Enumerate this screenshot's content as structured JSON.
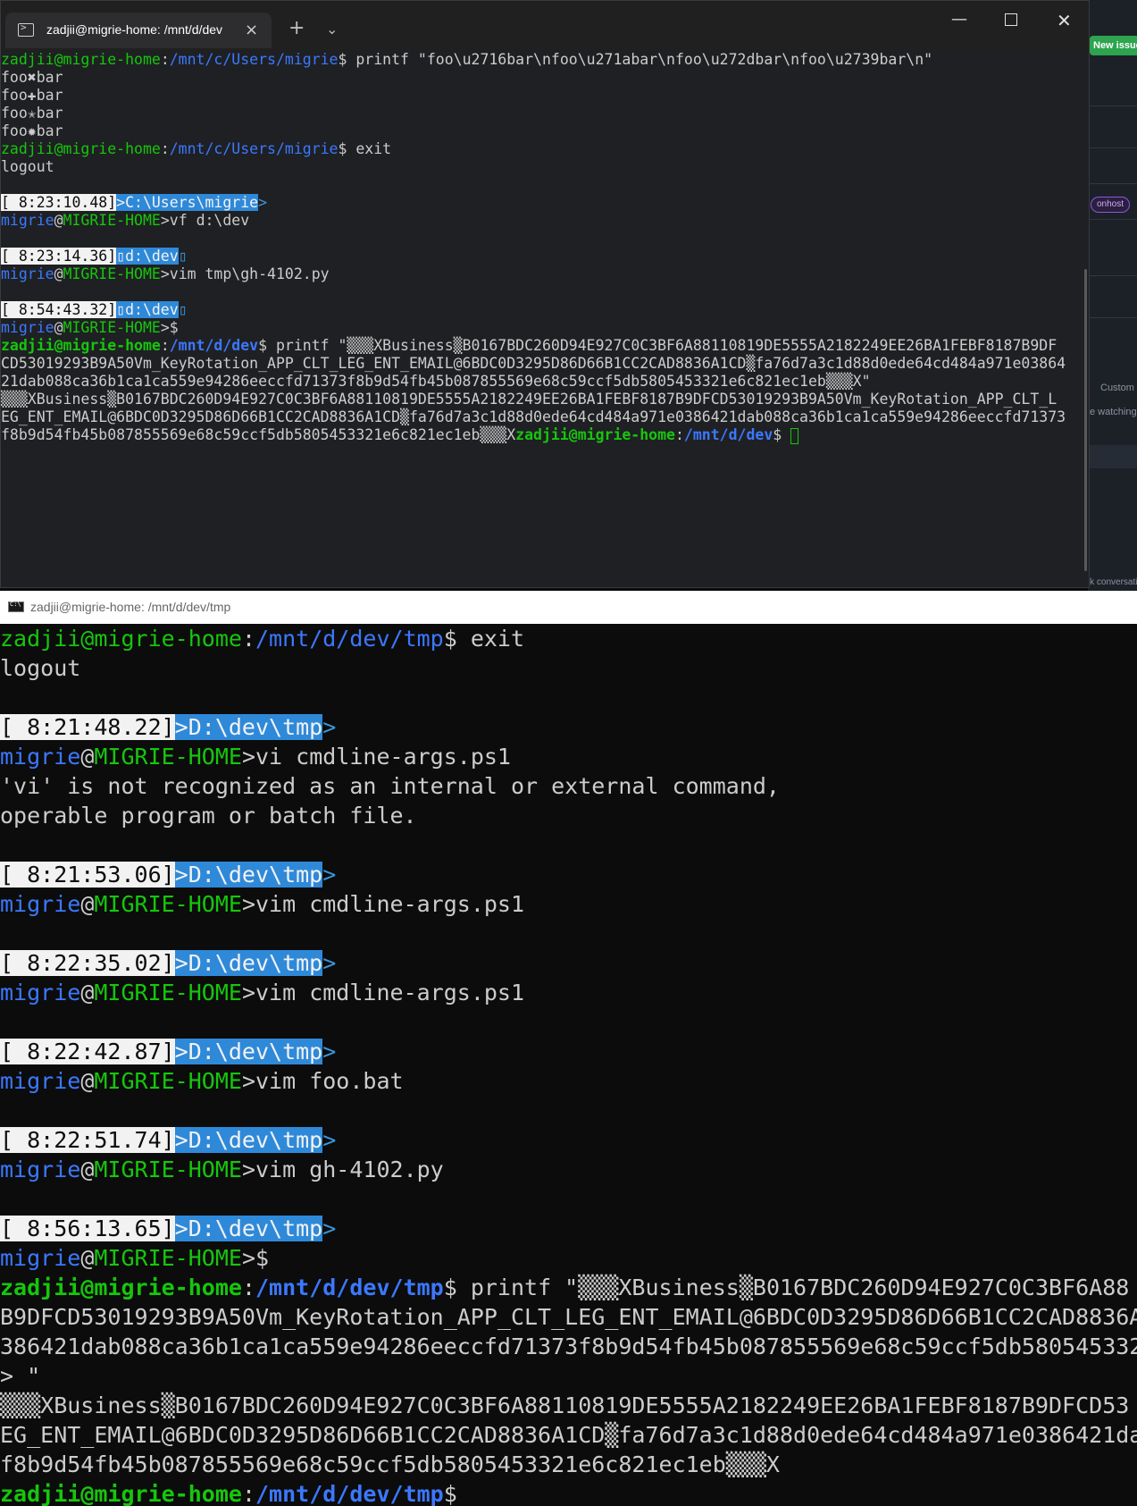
{
  "background_app": {
    "new_issue_label": "New issue",
    "pill_label": "onhost",
    "custom_label": "Custom",
    "watching_label": "e watching",
    "footer_label": "Lock conversation"
  },
  "windows_terminal": {
    "tab_title": "zadjii@migrie-home: /mnt/d/dev",
    "new_tab_glyph": "+",
    "dropdown_glyph": "⌄",
    "minimize_glyph": "—",
    "close_glyph": "✕",
    "lines": [
      [
        {
          "t": "zadjii@migrie-home",
          "c": "g"
        },
        {
          "t": ":"
        },
        {
          "t": "/mnt/c/Users/migrie",
          "c": "b"
        },
        {
          "t": "$ printf \"foo\\u2716bar\\nfoo\\u271abar\\nfoo\\u272dbar\\nfoo\\u2739bar\\n\""
        }
      ],
      [
        {
          "t": "foo✖bar"
        }
      ],
      [
        {
          "t": "foo✚bar"
        }
      ],
      [
        {
          "t": "foo✭bar"
        }
      ],
      [
        {
          "t": "foo✹bar"
        }
      ],
      [
        {
          "t": "zadjii@migrie-home",
          "c": "g"
        },
        {
          "t": ":"
        },
        {
          "t": "/mnt/c/Users/migrie",
          "c": "b"
        },
        {
          "t": "$ exit"
        }
      ],
      [
        {
          "t": "logout"
        }
      ],
      [
        {
          "t": ""
        }
      ],
      [
        {
          "t": "[ 8:23:10.48]",
          "c": "time"
        },
        {
          "t": ">C:\\Users\\migrie",
          "c": "cwd"
        },
        {
          "t": ">",
          "c": "arrow"
        }
      ],
      [
        {
          "t": "migrie",
          "c": "b"
        },
        {
          "t": "@"
        },
        {
          "t": "MIGRIE-HOME",
          "c": "g"
        },
        {
          "t": ">vf d:\\dev"
        }
      ],
      [
        {
          "t": ""
        }
      ],
      [
        {
          "t": "[ 8:23:14.36]",
          "c": "time"
        },
        {
          "t": "▯d:\\dev",
          "c": "cwd"
        },
        {
          "t": "▯",
          "c": "arrow"
        }
      ],
      [
        {
          "t": "migrie",
          "c": "b"
        },
        {
          "t": "@"
        },
        {
          "t": "MIGRIE-HOME",
          "c": "g"
        },
        {
          "t": ">vim tmp\\gh-4102.py"
        }
      ],
      [
        {
          "t": ""
        }
      ],
      [
        {
          "t": "[ 8:54:43.32]",
          "c": "time"
        },
        {
          "t": "▯d:\\dev",
          "c": "cwd"
        },
        {
          "t": "▯",
          "c": "arrow"
        }
      ],
      [
        {
          "t": "migrie",
          "c": "b"
        },
        {
          "t": "@"
        },
        {
          "t": "MIGRIE-HOME",
          "c": "g"
        },
        {
          "t": ">$"
        }
      ],
      [
        {
          "t": "zadjii@migrie-home",
          "c": "gb"
        },
        {
          "t": ":"
        },
        {
          "t": "/mnt/d/dev",
          "c": "bb"
        },
        {
          "t": "$ printf \"▒▒▒XBusiness▒B0167BDC260D94E927C0C3BF6A88110819DE5555A2182249EE26BA1FEBF8187B9DF"
        }
      ],
      [
        {
          "t": "CD53019293B9A50Vm_KeyRotation_APP_CLT_LEG_ENT_EMAIL@6BDC0D3295D86D66B1CC2CAD8836A1CD▒fa76d7a3c1d88d0ede64cd484a971e03864"
        }
      ],
      [
        {
          "t": "21dab088ca36b1ca1ca559e94286eeccfd71373f8b9d54fb45b087855569e68c59ccf5db5805453321e6c821ec1eb▒▒▒X\""
        }
      ],
      [
        {
          "t": "▒▒▒XBusiness▒B0167BDC260D94E927C0C3BF6A88110819DE5555A2182249EE26BA1FEBF8187B9DFCD53019293B9A50Vm_KeyRotation_APP_CLT_L"
        }
      ],
      [
        {
          "t": "EG_ENT_EMAIL@6BDC0D3295D86D66B1CC2CAD8836A1CD▒fa76d7a3c1d88d0ede64cd484a971e0386421dab088ca36b1ca1ca559e94286eeccfd71373"
        }
      ],
      [
        {
          "t": "f8b9d54fb45b087855569e68c59ccf5db5805453321e6c821ec1eb▒▒▒X"
        },
        {
          "t": "zadjii@migrie-home",
          "c": "gb"
        },
        {
          "t": ":"
        },
        {
          "t": "/mnt/d/dev",
          "c": "bb"
        },
        {
          "t": "$ "
        }
      ]
    ]
  },
  "conhost": {
    "title": "zadjii@migrie-home: /mnt/d/dev/tmp",
    "lines": [
      [
        {
          "t": "zadjii@migrie-home",
          "c": "g"
        },
        {
          "t": ":"
        },
        {
          "t": "/mnt/d/dev/tmp",
          "c": "b"
        },
        {
          "t": "$ exit"
        }
      ],
      [
        {
          "t": "logout"
        }
      ],
      [
        {
          "t": ""
        }
      ],
      [
        {
          "t": "[ 8:21:48.22]",
          "c": "time"
        },
        {
          "t": ">D:\\dev\\tmp",
          "c": "cwd"
        },
        {
          "t": ">",
          "c": "arrow"
        }
      ],
      [
        {
          "t": "migrie",
          "c": "b"
        },
        {
          "t": "@"
        },
        {
          "t": "MIGRIE-HOME",
          "c": "g"
        },
        {
          "t": ">vi cmdline-args.ps1"
        }
      ],
      [
        {
          "t": "'vi' is not recognized as an internal or external command,"
        }
      ],
      [
        {
          "t": "operable program or batch file."
        }
      ],
      [
        {
          "t": ""
        }
      ],
      [
        {
          "t": "[ 8:21:53.06]",
          "c": "time"
        },
        {
          "t": ">D:\\dev\\tmp",
          "c": "cwd"
        },
        {
          "t": ">",
          "c": "arrow"
        }
      ],
      [
        {
          "t": "migrie",
          "c": "b"
        },
        {
          "t": "@"
        },
        {
          "t": "MIGRIE-HOME",
          "c": "g"
        },
        {
          "t": ">vim cmdline-args.ps1"
        }
      ],
      [
        {
          "t": ""
        }
      ],
      [
        {
          "t": "[ 8:22:35.02]",
          "c": "time"
        },
        {
          "t": ">D:\\dev\\tmp",
          "c": "cwd"
        },
        {
          "t": ">",
          "c": "arrow"
        }
      ],
      [
        {
          "t": "migrie",
          "c": "b"
        },
        {
          "t": "@"
        },
        {
          "t": "MIGRIE-HOME",
          "c": "g"
        },
        {
          "t": ">vim cmdline-args.ps1"
        }
      ],
      [
        {
          "t": ""
        }
      ],
      [
        {
          "t": "[ 8:22:42.87]",
          "c": "time"
        },
        {
          "t": ">D:\\dev\\tmp",
          "c": "cwd"
        },
        {
          "t": ">",
          "c": "arrow"
        }
      ],
      [
        {
          "t": "migrie",
          "c": "b"
        },
        {
          "t": "@"
        },
        {
          "t": "MIGRIE-HOME",
          "c": "g"
        },
        {
          "t": ">vim foo.bat"
        }
      ],
      [
        {
          "t": ""
        }
      ],
      [
        {
          "t": "[ 8:22:51.74]",
          "c": "time"
        },
        {
          "t": ">D:\\dev\\tmp",
          "c": "cwd"
        },
        {
          "t": ">",
          "c": "arrow"
        }
      ],
      [
        {
          "t": "migrie",
          "c": "b"
        },
        {
          "t": "@"
        },
        {
          "t": "MIGRIE-HOME",
          "c": "g"
        },
        {
          "t": ">vim gh-4102.py"
        }
      ],
      [
        {
          "t": ""
        }
      ],
      [
        {
          "t": "[ 8:56:13.65]",
          "c": "time"
        },
        {
          "t": ">D:\\dev\\tmp",
          "c": "cwd"
        },
        {
          "t": ">",
          "c": "arrow"
        }
      ],
      [
        {
          "t": "migrie",
          "c": "b"
        },
        {
          "t": "@"
        },
        {
          "t": "MIGRIE-HOME",
          "c": "g"
        },
        {
          "t": ">$"
        }
      ],
      [
        {
          "t": "zadjii@migrie-home",
          "c": "gb"
        },
        {
          "t": ":"
        },
        {
          "t": "/mnt/d/dev/tmp",
          "c": "bb"
        },
        {
          "t": "$ printf \"▒▒▒XBusiness▒B0167BDC260D94E927C0C3BF6A88"
        }
      ],
      [
        {
          "t": "B9DFCD53019293B9A50Vm_KeyRotation_APP_CLT_LEG_ENT_EMAIL@6BDC0D3295D86D66B1CC2CAD8836A"
        }
      ],
      [
        {
          "t": "386421dab088ca36b1ca1ca559e94286eeccfd71373f8b9d54fb45b087855569e68c59ccf5db580545332"
        }
      ],
      [
        {
          "t": "> \""
        }
      ],
      [
        {
          "t": "▒▒▒XBusiness▒B0167BDC260D94E927C0C3BF6A88110819DE5555A2182249EE26BA1FEBF8187B9DFCD53"
        }
      ],
      [
        {
          "t": "EG_ENT_EMAIL@6BDC0D3295D86D66B1CC2CAD8836A1CD▒fa76d7a3c1d88d0ede64cd484a971e0386421da"
        }
      ],
      [
        {
          "t": "f8b9d54fb45b087855569e68c59ccf5db5805453321e6c821ec1eb▒▒▒X"
        }
      ],
      [
        {
          "t": "zadjii@migrie-home",
          "c": "gb"
        },
        {
          "t": ":"
        },
        {
          "t": "/mnt/d/dev/tmp",
          "c": "bb"
        },
        {
          "t": "$"
        }
      ]
    ]
  },
  "colors": {
    "green": "#16c60c",
    "blue": "#3b78ff",
    "cwd_bg": "#2f89d9",
    "terminal_bg": "#1f2023",
    "conhost_bg": "#0c0c0c"
  }
}
